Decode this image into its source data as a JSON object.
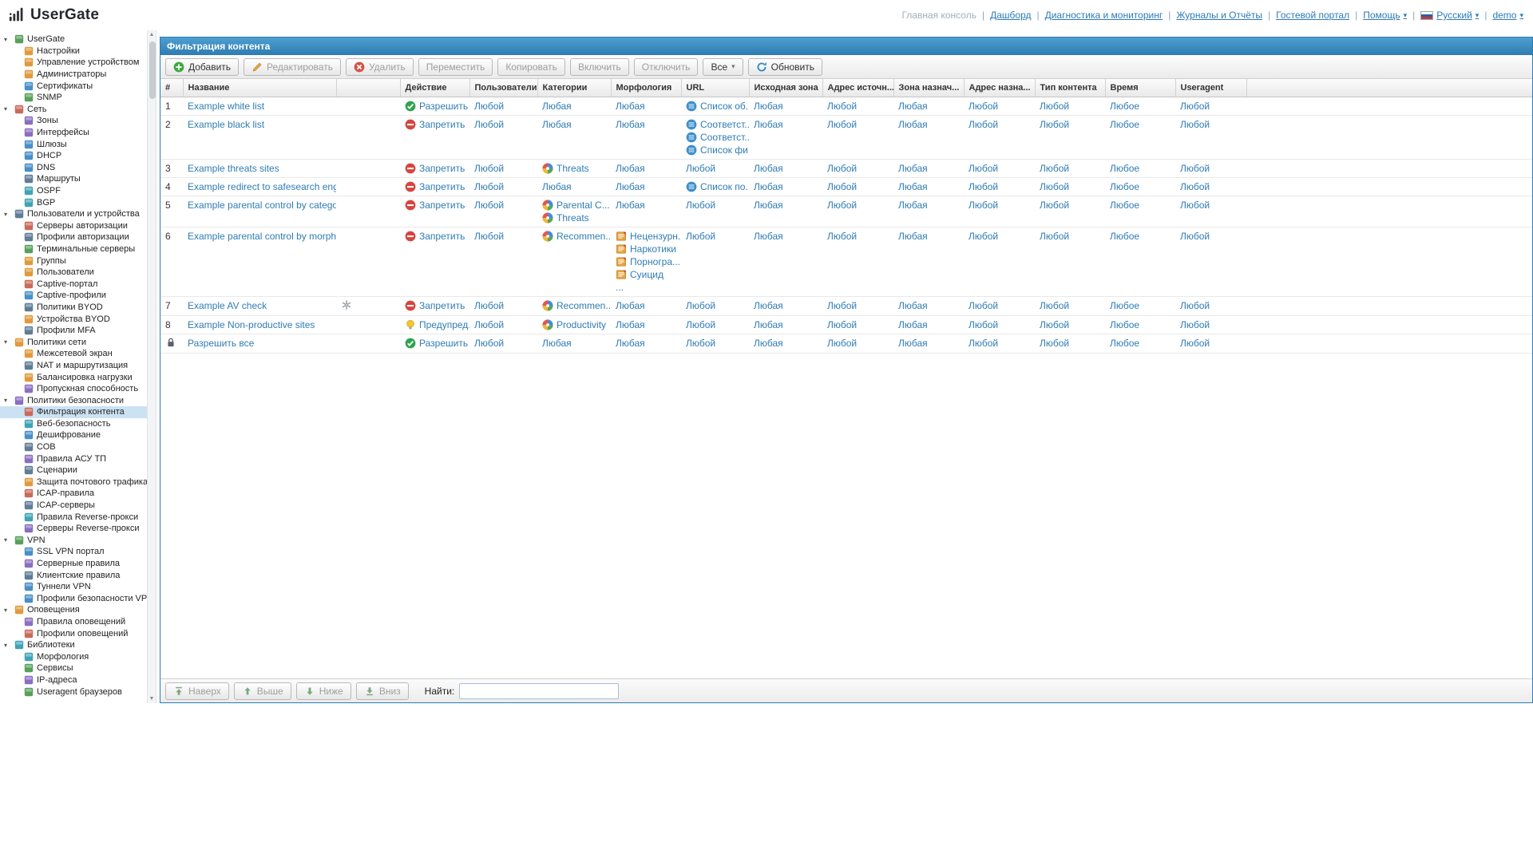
{
  "brand": {
    "name": "UserGate"
  },
  "top_nav": {
    "items": [
      {
        "name": "main-console",
        "label": "Главная консоль",
        "state": "current"
      },
      {
        "name": "dashboard",
        "label": "Дашборд"
      },
      {
        "name": "diagnostics-monitoring",
        "label": "Диагностика и мониторинг"
      },
      {
        "name": "logs-reports",
        "label": "Журналы и Отчёты"
      },
      {
        "name": "guest-portal",
        "label": "Гостевой портал"
      },
      {
        "name": "help",
        "label": "Помощь",
        "dropdown": true
      },
      {
        "name": "language",
        "label": "Русский",
        "dropdown": true,
        "flag": true
      },
      {
        "name": "user-menu",
        "label": "demo",
        "dropdown": true
      }
    ]
  },
  "sidebar": {
    "selected": "Фильтрация контента",
    "sections": [
      {
        "name": "usergate",
        "label": "UserGate",
        "icon": "usergate-globe-icon",
        "items": [
          {
            "name": "settings",
            "label": "Настройки",
            "icon": "gear-icon"
          },
          {
            "name": "device-management",
            "label": "Управление устройством",
            "icon": "device-management-icon"
          },
          {
            "name": "administrators",
            "label": "Администраторы",
            "icon": "admin-user-icon"
          },
          {
            "name": "certificates",
            "label": "Сертификаты",
            "icon": "certificate-icon"
          },
          {
            "name": "snmp",
            "label": "SNMP",
            "icon": "snmp-icon"
          }
        ]
      },
      {
        "name": "network",
        "label": "Сеть",
        "icon": "network-icon",
        "items": [
          {
            "name": "zones",
            "label": "Зоны",
            "icon": "zones-icon"
          },
          {
            "name": "interfaces",
            "label": "Интерфейсы",
            "icon": "interfaces-icon"
          },
          {
            "name": "gateways",
            "label": "Шлюзы",
            "icon": "gateways-icon"
          },
          {
            "name": "dhcp",
            "label": "DHCP",
            "icon": "dhcp-icon"
          },
          {
            "name": "dns",
            "label": "DNS",
            "icon": "dns-icon"
          },
          {
            "name": "routes",
            "label": "Маршруты",
            "icon": "routes-icon"
          },
          {
            "name": "ospf",
            "label": "OSPF",
            "icon": "ospf-icon"
          },
          {
            "name": "bgp",
            "label": "BGP",
            "icon": "bgp-icon"
          }
        ]
      },
      {
        "name": "users-devices",
        "label": "Пользователи и устройства",
        "icon": "users-devices-icon",
        "items": [
          {
            "name": "auth-servers",
            "label": "Серверы авторизации",
            "icon": "auth-servers-icon"
          },
          {
            "name": "auth-profiles",
            "label": "Профили авторизации",
            "icon": "auth-profiles-icon"
          },
          {
            "name": "terminal-servers",
            "label": "Терминальные серверы",
            "icon": "terminal-servers-icon"
          },
          {
            "name": "groups",
            "label": "Группы",
            "icon": "groups-icon"
          },
          {
            "name": "users",
            "label": "Пользователи",
            "icon": "users-icon"
          },
          {
            "name": "captive-portal",
            "label": "Captive-портал",
            "icon": "captive-portal-icon"
          },
          {
            "name": "captive-profiles",
            "label": "Captive-профили",
            "icon": "captive-profiles-icon"
          },
          {
            "name": "byod-policies",
            "label": "Политики BYOD",
            "icon": "byod-policies-icon"
          },
          {
            "name": "byod-devices",
            "label": "Устройства BYOD",
            "icon": "byod-devices-icon"
          },
          {
            "name": "mfa-profiles",
            "label": "Профили MFA",
            "icon": "mfa-profiles-icon"
          }
        ]
      },
      {
        "name": "network-policies",
        "label": "Политики сети",
        "icon": "network-policies-icon",
        "items": [
          {
            "name": "firewall",
            "label": "Межсетевой экран",
            "icon": "firewall-icon"
          },
          {
            "name": "nat-routing",
            "label": "NAT и маршрутизация",
            "icon": "nat-routing-icon"
          },
          {
            "name": "load-balancing",
            "label": "Балансировка нагрузки",
            "icon": "load-balancing-icon"
          },
          {
            "name": "bandwidth",
            "label": "Пропускная способность",
            "icon": "bandwidth-icon"
          }
        ]
      },
      {
        "name": "security-policies",
        "label": "Политики безопасности",
        "icon": "security-policies-icon",
        "items": [
          {
            "name": "content-filtering",
            "label": "Фильтрация контента",
            "icon": "content-filtering-icon"
          },
          {
            "name": "web-security",
            "label": "Веб-безопасность",
            "icon": "web-security-icon"
          },
          {
            "name": "decryption",
            "label": "Дешифрование",
            "icon": "decryption-icon"
          },
          {
            "name": "ips",
            "label": "СОВ",
            "icon": "ips-icon"
          },
          {
            "name": "scada-rules",
            "label": "Правила АСУ ТП",
            "icon": "scada-rules-icon"
          },
          {
            "name": "scenarios",
            "label": "Сценарии",
            "icon": "scenarios-icon"
          },
          {
            "name": "mail-protection",
            "label": "Защита почтового трафика",
            "icon": "mail-protection-icon"
          },
          {
            "name": "icap-rules",
            "label": "ICAP-правила",
            "icon": "icap-rules-icon"
          },
          {
            "name": "icap-servers",
            "label": "ICAP-серверы",
            "icon": "icap-servers-icon"
          },
          {
            "name": "reverse-proxy-rules",
            "label": "Правила Reverse-прокси",
            "icon": "reverse-proxy-rules-icon"
          },
          {
            "name": "reverse-proxy-servers",
            "label": "Серверы Reverse-прокси",
            "icon": "reverse-proxy-servers-icon"
          }
        ]
      },
      {
        "name": "vpn",
        "label": "VPN",
        "icon": "vpn-icon",
        "items": [
          {
            "name": "ssl-vpn-portal",
            "label": "SSL VPN портал",
            "icon": "ssl-vpn-portal-icon"
          },
          {
            "name": "vpn-server-rules",
            "label": "Серверные правила",
            "icon": "vpn-server-rules-icon"
          },
          {
            "name": "vpn-client-rules",
            "label": "Клиентские правила",
            "icon": "vpn-client-rules-icon"
          },
          {
            "name": "vpn-tunnels",
            "label": "Туннели VPN",
            "icon": "vpn-tunnels-icon"
          },
          {
            "name": "vpn-security-profiles",
            "label": "Профили безопасности VPN",
            "icon": "vpn-security-profiles-icon"
          }
        ]
      },
      {
        "name": "notifications",
        "label": "Оповещения",
        "icon": "notifications-icon",
        "items": [
          {
            "name": "alert-rules",
            "label": "Правила оповещений",
            "icon": "alert-rules-icon"
          },
          {
            "name": "alert-profiles",
            "label": "Профили оповещений",
            "icon": "alert-profiles-icon"
          }
        ]
      },
      {
        "name": "libraries",
        "label": "Библиотеки",
        "icon": "libraries-icon",
        "items": [
          {
            "name": "morphology",
            "label": "Морфология",
            "icon": "morphology-icon"
          },
          {
            "name": "services",
            "label": "Сервисы",
            "icon": "services-icon"
          },
          {
            "name": "ip-addresses",
            "label": "IP-адреса",
            "icon": "ip-addresses-icon"
          },
          {
            "name": "useragents",
            "label": "Useragent браузеров",
            "icon": "useragents-icon"
          }
        ]
      }
    ]
  },
  "panel": {
    "title": "Фильтрация контента",
    "toolbar": {
      "buttons": [
        {
          "name": "add",
          "label": "Добавить",
          "icon": "add-icon",
          "enabled": true
        },
        {
          "name": "edit",
          "label": "Редактировать",
          "icon": "edit-icon",
          "enabled": false
        },
        {
          "name": "delete",
          "label": "Удалить",
          "icon": "delete-icon",
          "enabled": false
        },
        {
          "name": "move",
          "label": "Переместить",
          "icon": "",
          "enabled": false
        },
        {
          "name": "copy",
          "label": "Копировать",
          "icon": "",
          "enabled": false
        },
        {
          "name": "enable",
          "label": "Включить",
          "icon": "",
          "enabled": false
        },
        {
          "name": "disable",
          "label": "Отключить",
          "icon": "",
          "enabled": false
        }
      ],
      "filter": {
        "value": "Все"
      },
      "refresh": {
        "label": "Обновить",
        "icon": "refresh-icon"
      }
    },
    "table": {
      "columns": [
        "#",
        "Название",
        "",
        "Действие",
        "Пользователи",
        "Категории",
        "Морфология",
        "URL",
        "Исходная зона",
        "Адрес источн...",
        "Зона назнач...",
        "Адрес назна...",
        "Тип контента",
        "Время",
        "Useragent"
      ],
      "rows": [
        {
          "num": "1",
          "name": "Example white list",
          "action": {
            "type": "allow",
            "label": "Разрешить"
          },
          "users": "Любой",
          "categories": [
            {
              "label": "Любая",
              "icon": false
            }
          ],
          "morphology": [
            {
              "label": "Любая",
              "icon": false
            }
          ],
          "url": [
            {
              "label": "Список об...",
              "icon": true
            }
          ],
          "src_zone": "Любая",
          "src_addr": "Любой",
          "dst_zone": "Любая",
          "dst_addr": "Любой",
          "content_type": "Любой",
          "time": "Любое",
          "useragent": "Любой"
        },
        {
          "num": "2",
          "name": "Example black list",
          "action": {
            "type": "deny",
            "label": "Запретить"
          },
          "users": "Любой",
          "categories": [
            {
              "label": "Любая",
              "icon": false
            }
          ],
          "morphology": [
            {
              "label": "Любая",
              "icon": false
            }
          ],
          "url": [
            {
              "label": "Соответст...",
              "icon": true
            },
            {
              "label": "Соответст...",
              "icon": true
            },
            {
              "label": "Список фи...",
              "icon": true
            }
          ],
          "src_zone": "Любая",
          "src_addr": "Любой",
          "dst_zone": "Любая",
          "dst_addr": "Любой",
          "content_type": "Любой",
          "time": "Любое",
          "useragent": "Любой"
        },
        {
          "num": "3",
          "name": "Example threats sites",
          "action": {
            "type": "deny",
            "label": "Запретить"
          },
          "users": "Любой",
          "categories": [
            {
              "label": "Threats",
              "icon": true
            }
          ],
          "morphology": [
            {
              "label": "Любая",
              "icon": false
            }
          ],
          "url": [
            {
              "label": "Любой",
              "icon": false
            }
          ],
          "src_zone": "Любая",
          "src_addr": "Любой",
          "dst_zone": "Любая",
          "dst_addr": "Любой",
          "content_type": "Любой",
          "time": "Любое",
          "useragent": "Любой"
        },
        {
          "num": "4",
          "name": "Example redirect to safesearch eng...",
          "action": {
            "type": "deny",
            "label": "Запретить"
          },
          "users": "Любой",
          "categories": [
            {
              "label": "Любая",
              "icon": false
            }
          ],
          "morphology": [
            {
              "label": "Любая",
              "icon": false
            }
          ],
          "url": [
            {
              "label": "Список по...",
              "icon": true
            }
          ],
          "src_zone": "Любая",
          "src_addr": "Любой",
          "dst_zone": "Любая",
          "dst_addr": "Любой",
          "content_type": "Любой",
          "time": "Любое",
          "useragent": "Любой"
        },
        {
          "num": "5",
          "name": "Example parental control by catego...",
          "action": {
            "type": "deny",
            "label": "Запретить"
          },
          "users": "Любой",
          "categories": [
            {
              "label": "Parental C...",
              "icon": true
            },
            {
              "label": "Threats",
              "icon": true
            }
          ],
          "morphology": [
            {
              "label": "Любая",
              "icon": false
            }
          ],
          "url": [
            {
              "label": "Любой",
              "icon": false
            }
          ],
          "src_zone": "Любая",
          "src_addr": "Любой",
          "dst_zone": "Любая",
          "dst_addr": "Любой",
          "content_type": "Любой",
          "time": "Любое",
          "useragent": "Любой"
        },
        {
          "num": "6",
          "name": "Example parental control by morph...",
          "action": {
            "type": "deny",
            "label": "Запретить"
          },
          "users": "Любой",
          "categories": [
            {
              "label": "Recommen...",
              "icon": true
            }
          ],
          "morphology": [
            {
              "label": "Нецензурн...",
              "icon": true
            },
            {
              "label": "Наркотики",
              "icon": true
            },
            {
              "label": "Порногра...",
              "icon": true
            },
            {
              "label": "Суицид",
              "icon": true
            },
            {
              "label": "...",
              "icon": false
            }
          ],
          "url": [
            {
              "label": "Любой",
              "icon": false
            }
          ],
          "src_zone": "Любая",
          "src_addr": "Любой",
          "dst_zone": "Любая",
          "dst_addr": "Любой",
          "content_type": "Любой",
          "time": "Любое",
          "useragent": "Любой"
        },
        {
          "num": "7",
          "name": "Example AV check",
          "flag": "gear",
          "action": {
            "type": "deny",
            "label": "Запретить"
          },
          "users": "Любой",
          "categories": [
            {
              "label": "Recommen...",
              "icon": true
            }
          ],
          "morphology": [
            {
              "label": "Любая",
              "icon": false
            }
          ],
          "url": [
            {
              "label": "Любой",
              "icon": false
            }
          ],
          "src_zone": "Любая",
          "src_addr": "Любой",
          "dst_zone": "Любая",
          "dst_addr": "Любой",
          "content_type": "Любой",
          "time": "Любое",
          "useragent": "Любой"
        },
        {
          "num": "8",
          "name": "Example Non-productive sites",
          "action": {
            "type": "warn",
            "label": "Предупред..."
          },
          "users": "Любой",
          "categories": [
            {
              "label": "Productivity",
              "icon": true
            }
          ],
          "morphology": [
            {
              "label": "Любая",
              "icon": false
            }
          ],
          "url": [
            {
              "label": "Любой",
              "icon": false
            }
          ],
          "src_zone": "Любая",
          "src_addr": "Любой",
          "dst_zone": "Любая",
          "dst_addr": "Любой",
          "content_type": "Любой",
          "time": "Любое",
          "useragent": "Любой"
        },
        {
          "num": "",
          "lock": true,
          "name": "Разрешить все",
          "action": {
            "type": "allow",
            "label": "Разрешить"
          },
          "users": "Любой",
          "categories": [
            {
              "label": "Любая",
              "icon": false
            }
          ],
          "morphology": [
            {
              "label": "Любая",
              "icon": false
            }
          ],
          "url": [
            {
              "label": "Любой",
              "icon": false
            }
          ],
          "src_zone": "Любая",
          "src_addr": "Любой",
          "dst_zone": "Любая",
          "dst_addr": "Любой",
          "content_type": "Любой",
          "time": "Любое",
          "useragent": "Любой"
        }
      ]
    },
    "footer": {
      "move_buttons": [
        "Наверх",
        "Выше",
        "Ниже",
        "Вниз"
      ],
      "find_label": "Найти:",
      "find_value": ""
    }
  }
}
